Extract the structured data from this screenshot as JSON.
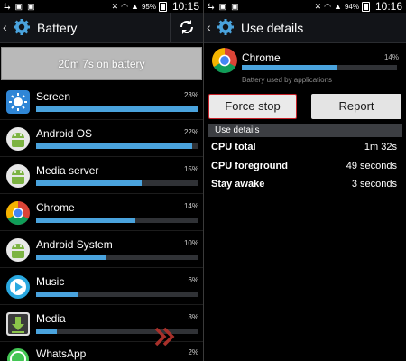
{
  "left": {
    "status": {
      "battery_pct": "95%",
      "time": "10:15"
    },
    "title": "Battery",
    "summary": "20m 7s on battery",
    "apps": [
      {
        "name": "Screen",
        "percent": "23%",
        "fill": 1.0,
        "icon": "screen-brightness-icon"
      },
      {
        "name": "Android OS",
        "percent": "22%",
        "fill": 0.96,
        "icon": "android-icon"
      },
      {
        "name": "Media server",
        "percent": "15%",
        "fill": 0.65,
        "icon": "android-icon"
      },
      {
        "name": "Chrome",
        "percent": "14%",
        "fill": 0.61,
        "icon": "chrome-icon"
      },
      {
        "name": "Android System",
        "percent": "10%",
        "fill": 0.43,
        "icon": "android-icon"
      },
      {
        "name": "Music",
        "percent": "6%",
        "fill": 0.26,
        "icon": "music-icon"
      },
      {
        "name": "Media",
        "percent": "3%",
        "fill": 0.13,
        "icon": "download-icon"
      },
      {
        "name": "WhatsApp",
        "percent": "2%",
        "fill": 0.09,
        "icon": "whatsapp-icon"
      }
    ]
  },
  "right": {
    "status": {
      "battery_pct": "94%",
      "time": "10:16"
    },
    "title": "Use details",
    "app": {
      "name": "Chrome",
      "percent": "14%",
      "fill": 0.61,
      "subtitle": "Battery used by applications"
    },
    "force_stop": "Force stop",
    "report": "Report",
    "section": "Use details",
    "details": [
      {
        "label": "CPU total",
        "value": "1m 32s"
      },
      {
        "label": "CPU foreground",
        "value": "49 seconds"
      },
      {
        "label": "Stay awake",
        "value": "3 seconds"
      }
    ]
  },
  "colors": {
    "bar_fill": "#4aa3dd",
    "bar_track": "#303236",
    "summary_bg": "#b9b9b9",
    "force_stop_border": "#c7222a",
    "accent_chevron": "#c0392b"
  }
}
